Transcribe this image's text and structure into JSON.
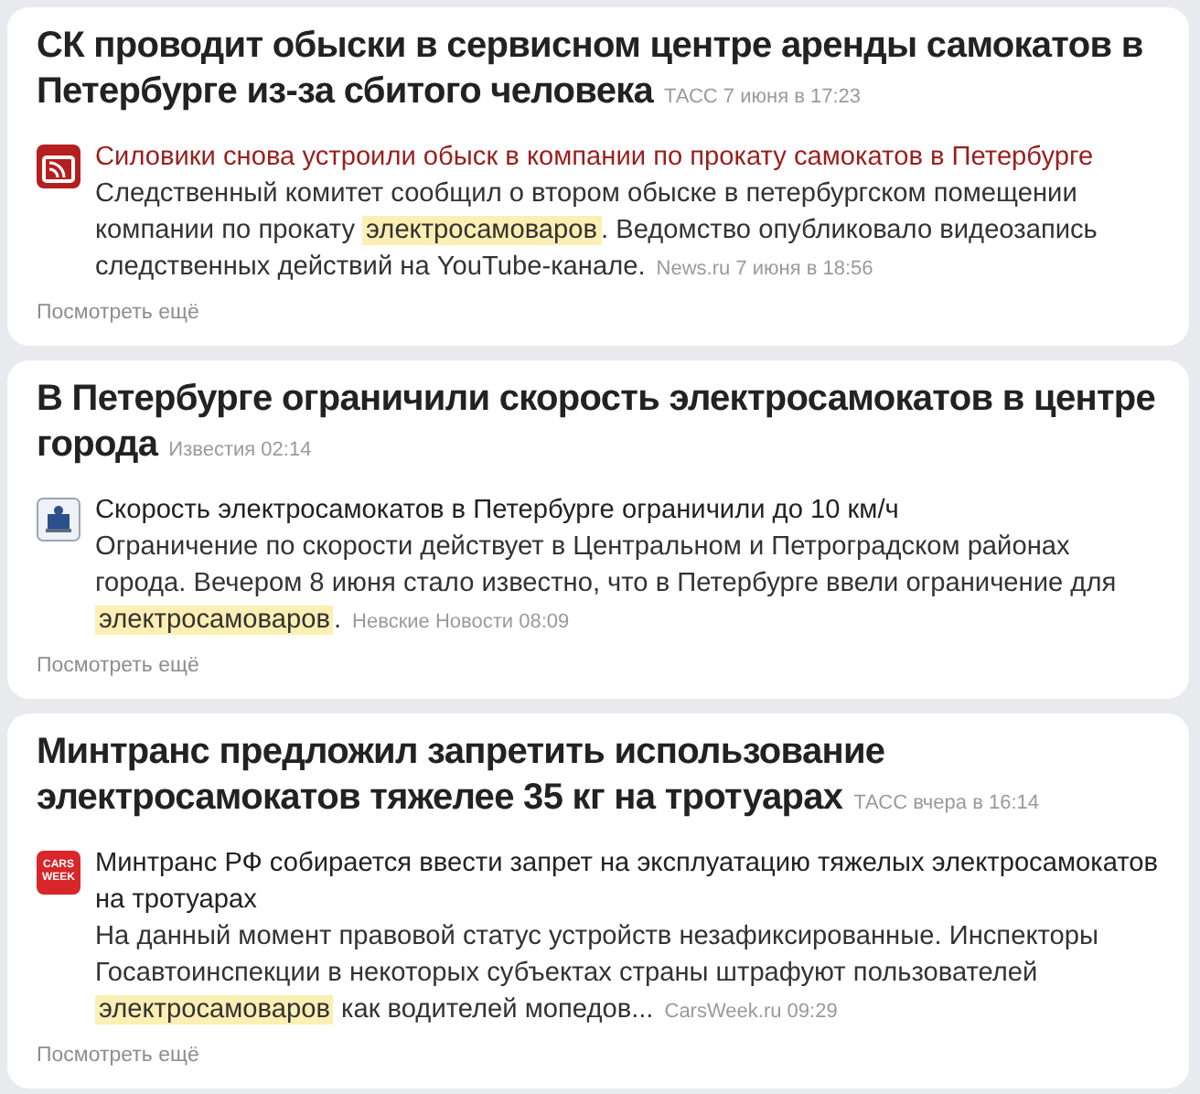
{
  "stories": [
    {
      "headline": "СК проводит обыски в сервисном центре аренды самокатов в Петербурге из-за сбитого человека",
      "headline_meta": "ТАСС 7 июня в 17:23",
      "source_icon": {
        "kind": "rss"
      },
      "snippet_title": "Силовики снова устроили обыск в компании по прокату самокатов в Петербурге",
      "visited": true,
      "body": [
        {
          "text": "Следственный комитет сообщил о втором обыске в петербургском помещении компании по прокату ",
          "highlight": false
        },
        {
          "text": "электросамоваров",
          "highlight": true
        },
        {
          "text": ". Ведомство опубликовало видеозапись следственных действий на YouTube-канале.",
          "highlight": false
        }
      ],
      "body_meta": "News.ru 7 июня в 18:56",
      "more": "Посмотреть ещё"
    },
    {
      "headline": "В Петербурге ограничили скорость электросамокатов в центре города",
      "headline_meta": "Известия 02:14",
      "source_icon": {
        "kind": "crest"
      },
      "snippet_title": "Скорость электросамокатов в Петербурге ограничили до 10 км/ч",
      "visited": false,
      "body": [
        {
          "text": "Ограничение по скорости действует в Центральном и Петроградском районах города. Вечером 8 июня стало известно, что в Петербурге ввели ограничение для ",
          "highlight": false
        },
        {
          "text": "электросамоваров",
          "highlight": true
        },
        {
          "text": ".",
          "highlight": false
        }
      ],
      "body_meta": "Невские Новости 08:09",
      "more": "Посмотреть ещё"
    },
    {
      "headline": "Минтранс предложил запретить использование электросамокатов тяжелее 35 кг на тротуарах",
      "headline_meta": "ТАСС вчера в 16:14",
      "source_icon": {
        "kind": "badge",
        "lines": [
          "CARS",
          "WEEK"
        ]
      },
      "snippet_title": "Минтранс РФ собирается ввести запрет на эксплуатацию тяжелых электросамокатов на тротуарах",
      "visited": false,
      "body": [
        {
          "text": "На данный момент правовой статус устройств незафиксированные. Инспекторы Госавтоинспекции в некоторых субъектах страны штрафуют пользователей ",
          "highlight": false
        },
        {
          "text": "электросамоваров",
          "highlight": true
        },
        {
          "text": " как водителей мопедов...",
          "highlight": false
        }
      ],
      "body_meta": "CarsWeek.ru 09:29",
      "more": "Посмотреть ещё"
    }
  ]
}
